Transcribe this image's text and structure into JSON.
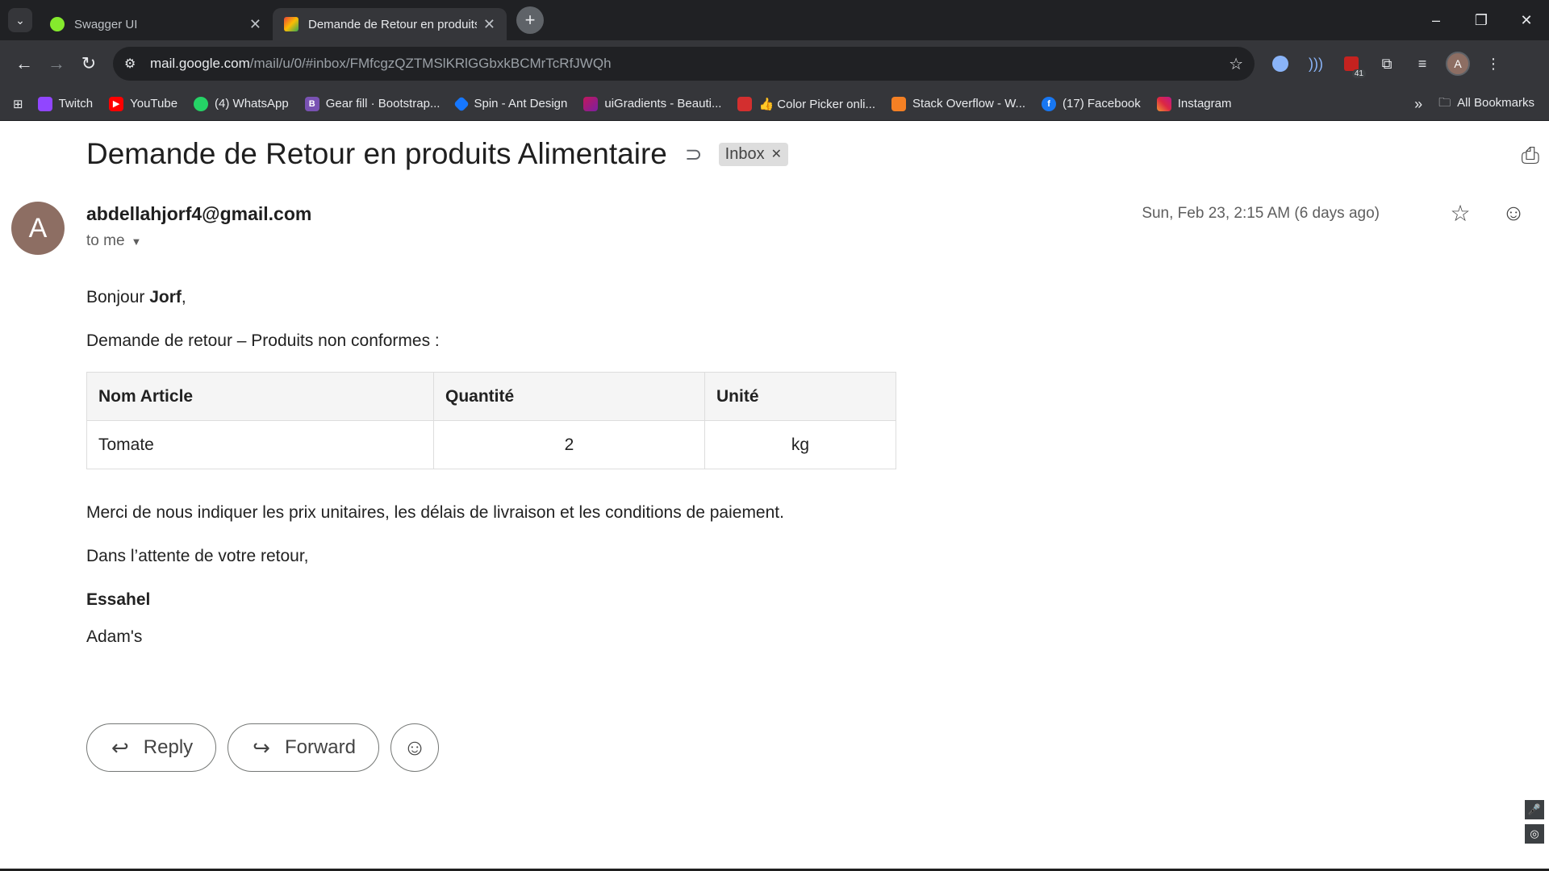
{
  "browser": {
    "tabs": [
      {
        "title": "Swagger UI",
        "active": false
      },
      {
        "title": "Demande de Retour en produits Alimentaire",
        "active": true
      }
    ],
    "url_host": "mail.google.com",
    "url_path": "/mail/u/0/#inbox/FMfcgzQZTMSlKRlGGbxkBCMrTcRfJWQh",
    "extension_badge": "41",
    "profile_initial": "A",
    "bookmarks": [
      "Twitch",
      "YouTube",
      "(4) WhatsApp",
      "Gear fill · Bootstrap...",
      "Spin - Ant Design",
      "uiGradients - Beauti...",
      "👍 Color Picker onli...",
      "Stack Overflow - W...",
      "(17) Facebook",
      "Instagram"
    ],
    "all_bookmarks": "All Bookmarks"
  },
  "email": {
    "subject": "Demande de Retour en produits Alimentaire",
    "label": "Inbox",
    "sender_initial": "A",
    "sender": "abdellahjorf4@gmail.com",
    "recipient": "to me",
    "date": "Sun, Feb 23, 2:15 AM (6 days ago)",
    "greeting_prefix": "Bonjour ",
    "greeting_name": "Jorf",
    "greeting_suffix": ",",
    "intro": "Demande de retour – Produits non conformes :",
    "table": {
      "headers": [
        "Nom Article",
        "Quantité",
        "Unité"
      ],
      "rows": [
        [
          "Tomate",
          "2",
          "kg"
        ]
      ]
    },
    "request": "Merci de nous indiquer les prix unitaires, les délais de livraison et les conditions de paiement.",
    "closing": "Dans l’attente de votre retour,",
    "signature_name": "Essahel",
    "signature_company": "Adam's"
  },
  "actions": {
    "reply": "Reply",
    "forward": "Forward"
  }
}
